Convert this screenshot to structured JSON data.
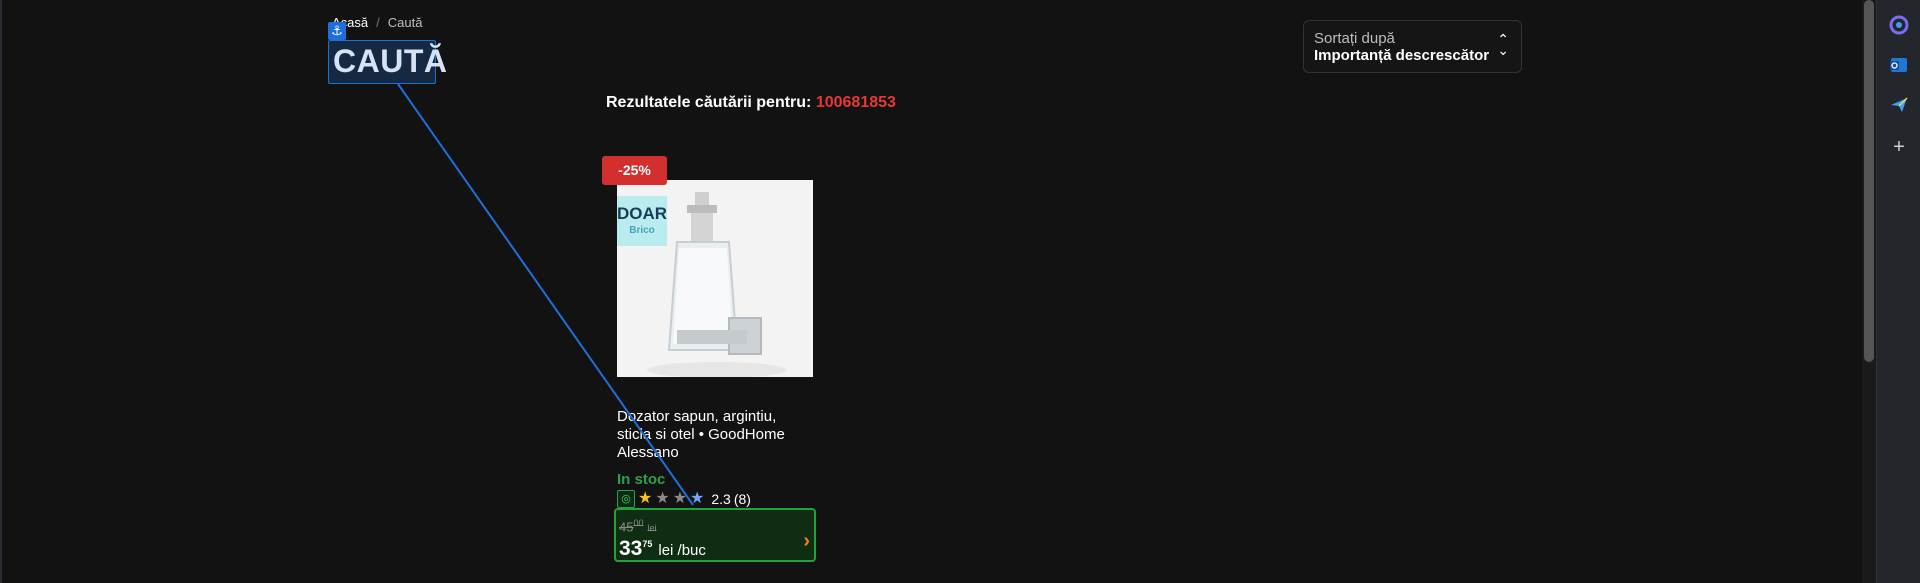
{
  "breadcrumb": {
    "home": "Acasă",
    "separator": "/",
    "current": "Caută"
  },
  "page": {
    "title": "CAUTĂ"
  },
  "sort": {
    "label": "Sortați după",
    "value": "Importanță descrescător"
  },
  "search": {
    "prefix": "Rezultatele căutării pentru:",
    "query": "100681853"
  },
  "product": {
    "discount": "-25%",
    "brand_badge": {
      "top": "DOAR",
      "bottom": "Brico"
    },
    "name": "Dozator sapun, argintiu, sticla si otel • GoodHome Alessano",
    "stock": "In stoc",
    "rating": 2.3,
    "rating_text": "2.3",
    "reviews": "(8)",
    "old_price": {
      "int": "45",
      "dec": "00",
      "unit": "lei"
    },
    "new_price": {
      "int": "33",
      "dec": "75",
      "unit": "lei /buc"
    }
  },
  "icons": {
    "anchor": "anchor-icon",
    "sort_chevron": "chevron-up-down-icon",
    "rating_target": "target-icon",
    "price_arrow": "chevron-right-icon",
    "sidebar": [
      "copilot-icon",
      "outlook-icon",
      "send-icon",
      "plus-icon"
    ]
  },
  "colors": {
    "background": "#121212",
    "accent_red": "#e53935",
    "stock_green": "#2e9e4c",
    "price_box_border": "#1fa33a",
    "selection_blue": "#1e6fd9"
  }
}
